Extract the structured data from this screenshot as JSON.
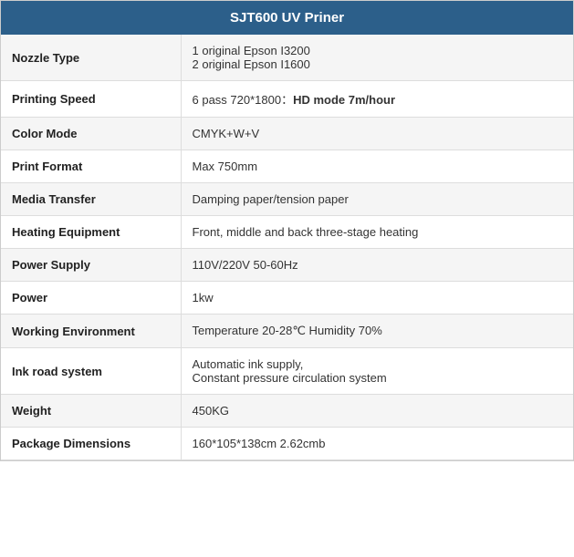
{
  "header": {
    "title": "SJT600 UV Priner"
  },
  "rows": [
    {
      "label": "Nozzle Type",
      "value": "1 original Epson I3200\n2 original Epson I1600",
      "multiline": true
    },
    {
      "label": "Printing Speed",
      "value_prefix": "6 pass 720*1800：",
      "value_bold": "HD mode 7m/hour",
      "mixed": true
    },
    {
      "label": "Color Mode",
      "value": "CMYK+W+V"
    },
    {
      "label": "Print Format",
      "value": "Max 750mm"
    },
    {
      "label": "Media Transfer",
      "value": "Damping paper/tension paper"
    },
    {
      "label": "Heating Equipment",
      "value": "Front, middle and back three-stage heating"
    },
    {
      "label": "Power Supply",
      "value": "110V/220V 50-60Hz"
    },
    {
      "label": "Power",
      "value": "1kw"
    },
    {
      "label": "Working Environment",
      "value": "Temperature 20-28℃ Humidity 70%"
    },
    {
      "label": "Ink road system",
      "value": "Automatic ink supply,\nConstant pressure circulation system",
      "multiline": true
    },
    {
      "label": "Weight",
      "value": "450KG"
    },
    {
      "label": "Package Dimensions",
      "value": "160*105*138cm 2.62cmb"
    }
  ]
}
